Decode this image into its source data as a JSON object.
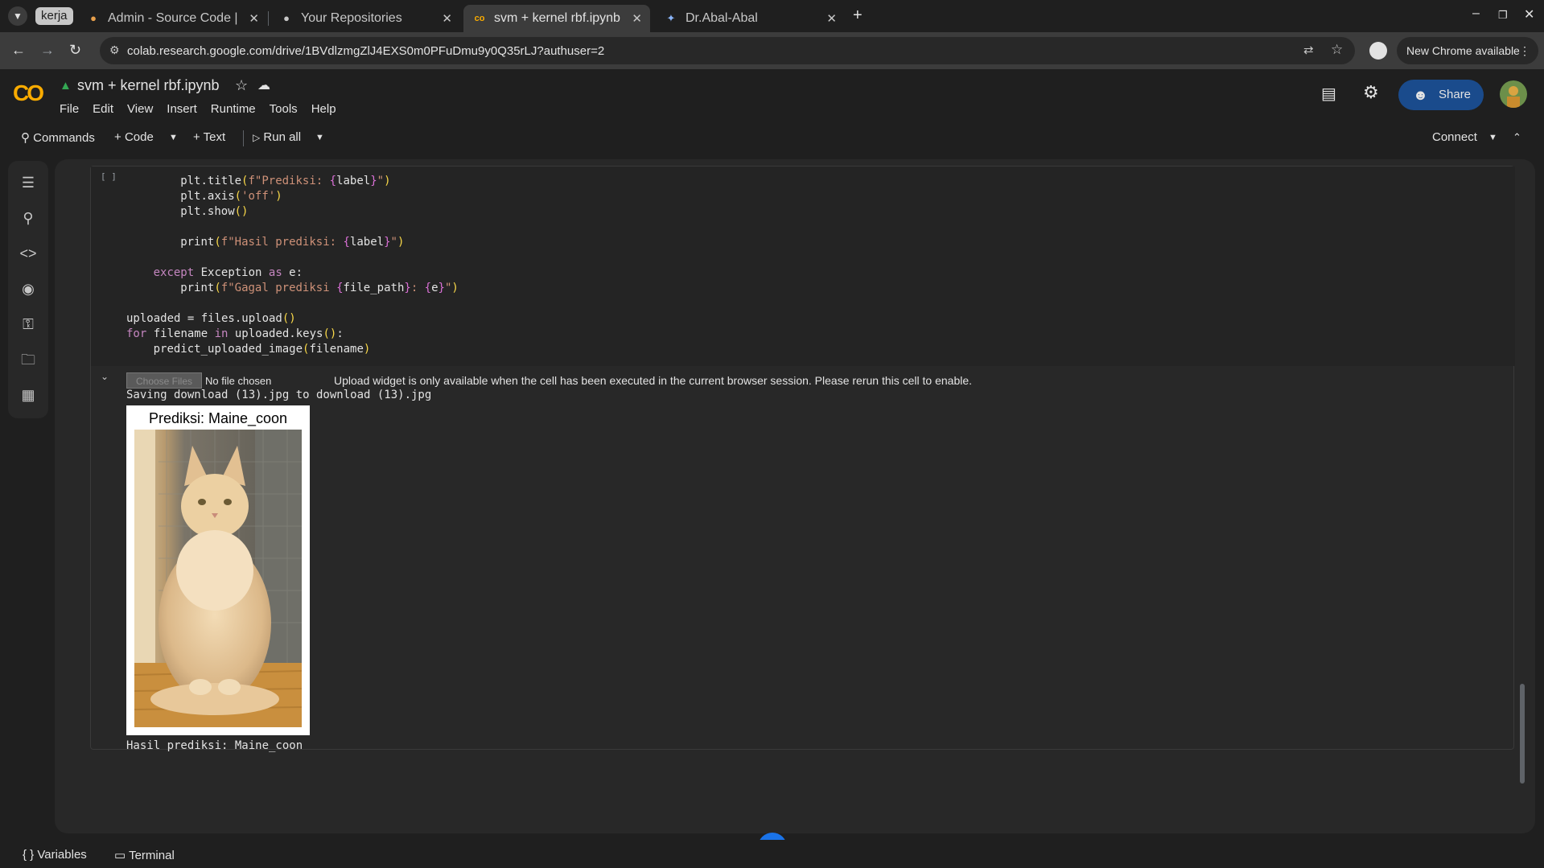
{
  "browser": {
    "tab_group_label": "kerja",
    "tabs": [
      {
        "title": "Admin - Source Code |",
        "icon": "admin-favicon",
        "active": false
      },
      {
        "title": "Your Repositories",
        "icon": "github-icon",
        "active": false
      },
      {
        "title": "svm + kernel rbf.ipynb",
        "icon": "colab-favicon",
        "active": true
      },
      {
        "title": "Dr.Abal-Abal",
        "icon": "app-favicon",
        "active": false
      }
    ],
    "url": "colab.research.google.com/drive/1BVdlzmgZlJ4EXS0m0PFuDmu9y0Q35rLJ?authuser=2",
    "new_chrome_label": "New Chrome available"
  },
  "colab": {
    "logo": "CO",
    "notebook_title": "svm + kernel rbf.ipynb",
    "menu": [
      "File",
      "Edit",
      "View",
      "Insert",
      "Runtime",
      "Tools",
      "Help"
    ],
    "share_label": "Share",
    "toolbar": {
      "commands": "Commands",
      "code": "Code",
      "text": "Text",
      "run_all": "Run all",
      "connect": "Connect"
    }
  },
  "cell": {
    "exec_bracket": "[ ]",
    "code_lines": [
      {
        "indent": 8,
        "parts": [
          [
            "fn",
            "plt.title"
          ],
          [
            "paren",
            "("
          ],
          [
            "str",
            "f\"Prediksi: "
          ],
          [
            "brace",
            "{"
          ],
          [
            "fn",
            "label"
          ],
          [
            "brace",
            "}"
          ],
          [
            "str",
            "\""
          ],
          [
            "paren",
            ")"
          ]
        ]
      },
      {
        "indent": 8,
        "parts": [
          [
            "fn",
            "plt.axis"
          ],
          [
            "paren",
            "("
          ],
          [
            "str",
            "'off'"
          ],
          [
            "paren",
            ")"
          ]
        ]
      },
      {
        "indent": 8,
        "parts": [
          [
            "fn",
            "plt.show"
          ],
          [
            "paren",
            "()"
          ]
        ]
      },
      {
        "indent": 0,
        "parts": []
      },
      {
        "indent": 8,
        "parts": [
          [
            "fn",
            "print"
          ],
          [
            "paren",
            "("
          ],
          [
            "str",
            "f\"Hasil prediksi: "
          ],
          [
            "brace",
            "{"
          ],
          [
            "fn",
            "label"
          ],
          [
            "brace",
            "}"
          ],
          [
            "str",
            "\""
          ],
          [
            "paren",
            ")"
          ]
        ]
      },
      {
        "indent": 0,
        "parts": []
      },
      {
        "indent": 4,
        "parts": [
          [
            "kw",
            "except"
          ],
          [
            "fn",
            " Exception "
          ],
          [
            "kw",
            "as"
          ],
          [
            "fn",
            " e:"
          ]
        ]
      },
      {
        "indent": 8,
        "parts": [
          [
            "fn",
            "print"
          ],
          [
            "paren",
            "("
          ],
          [
            "str",
            "f\"Gagal prediksi "
          ],
          [
            "brace",
            "{"
          ],
          [
            "fn",
            "file_path"
          ],
          [
            "brace",
            "}"
          ],
          [
            "str",
            ": "
          ],
          [
            "brace",
            "{"
          ],
          [
            "fn",
            "e"
          ],
          [
            "brace",
            "}"
          ],
          [
            "str",
            "\""
          ],
          [
            "paren",
            ")"
          ]
        ]
      },
      {
        "indent": 0,
        "parts": []
      },
      {
        "indent": 0,
        "parts": [
          [
            "fn",
            "uploaded = files.upload"
          ],
          [
            "paren",
            "()"
          ]
        ]
      },
      {
        "indent": 0,
        "parts": [
          [
            "kw",
            "for"
          ],
          [
            "fn",
            " filename "
          ],
          [
            "kw",
            "in"
          ],
          [
            "fn",
            " uploaded.keys"
          ],
          [
            "paren",
            "()"
          ],
          [
            "fn",
            ":"
          ]
        ]
      },
      {
        "indent": 4,
        "parts": [
          [
            "fn",
            "predict_uploaded_image"
          ],
          [
            "paren",
            "("
          ],
          [
            "fn",
            "filename"
          ],
          [
            "paren",
            ")"
          ]
        ]
      }
    ],
    "output": {
      "choose_files": "Choose Files",
      "no_file": "No file chosen",
      "widget_message": "Upload widget is only available when the cell has been executed in the current browser session. Please rerun this cell to enable.",
      "saving_line": "Saving download (13).jpg to download (13).jpg",
      "figure_title": "Prediksi: Maine_coon",
      "result_line": "Hasil prediksi: Maine_coon"
    }
  },
  "statusbar": {
    "variables": "Variables",
    "terminal": "Terminal"
  }
}
